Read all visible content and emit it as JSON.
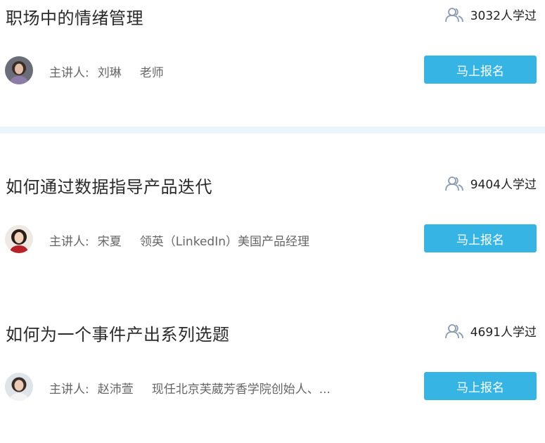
{
  "courses": [
    {
      "title": "职场中的情绪管理",
      "learners": "3032人学过",
      "lecturer_label": "主讲人:",
      "lecturer_name": "刘琳",
      "lecturer_title": "老师",
      "cta": "马上报名"
    },
    {
      "title": "如何通过数据指导产品迭代",
      "learners": "9404人学过",
      "lecturer_label": "主讲人:",
      "lecturer_name": "宋夏",
      "lecturer_title": "领英（LinkedIn）美国产品经理",
      "cta": "马上报名"
    },
    {
      "title": "如何为一个事件产出系列选题",
      "learners": "4691人学过",
      "lecturer_label": "主讲人:",
      "lecturer_name": "赵沛萱",
      "lecturer_title": "现任北京芙葳芳香学院创始人、...",
      "cta": "马上报名"
    }
  ],
  "colors": {
    "accent": "#36b4e3",
    "separator": "#eaf6fb",
    "learners_icon": "#8a9bb0"
  },
  "icons": {
    "learners": "users-icon",
    "avatar": "avatar"
  }
}
